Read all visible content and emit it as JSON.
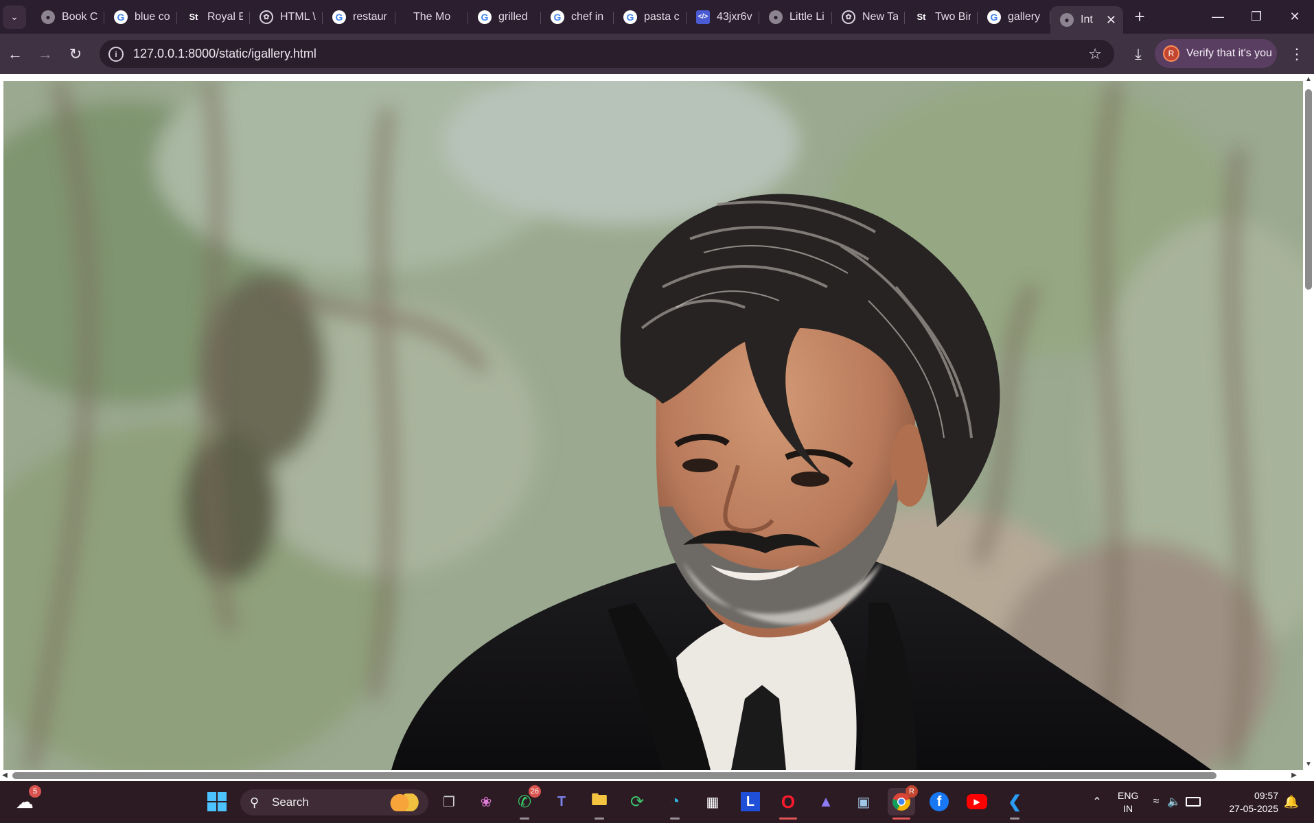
{
  "browser": {
    "tabs": [
      {
        "label": "Book C",
        "icon": "globe-icon"
      },
      {
        "label": "blue co",
        "icon": "google-icon"
      },
      {
        "label": "Royal E",
        "icon": "st-icon"
      },
      {
        "label": "HTML \\",
        "icon": "chatgpt-icon"
      },
      {
        "label": "restaur",
        "icon": "google-icon"
      },
      {
        "label": "The Mo",
        "icon": "none"
      },
      {
        "label": "grilled",
        "icon": "google-icon"
      },
      {
        "label": "chef in",
        "icon": "google-icon"
      },
      {
        "label": "pasta c",
        "icon": "google-icon"
      },
      {
        "label": "43jxr6v",
        "icon": "code-icon"
      },
      {
        "label": "Little Li",
        "icon": "globe-icon"
      },
      {
        "label": "New Ta",
        "icon": "chatgpt-icon"
      },
      {
        "label": "Two Bir",
        "icon": "st-icon"
      },
      {
        "label": "gallery",
        "icon": "google-icon"
      },
      {
        "label": "Int",
        "icon": "globe-icon",
        "active": true
      }
    ],
    "url": "127.0.0.1:8000/static/igallery.html",
    "verify_label": "Verify that it's you",
    "profile_initial": "R"
  },
  "taskbar": {
    "weather_badge": "5",
    "search_placeholder": "Search",
    "whatsapp_badge": "26",
    "chrome_badge": "R",
    "language": "ENG",
    "region": "IN",
    "time": "09:57",
    "date": "27-05-2025"
  },
  "colors": {
    "tabstrip": "#2b1e2e",
    "toolbar": "#3f3242",
    "omnibox": "#2a1e2d",
    "taskbar": "#2d1b24"
  }
}
